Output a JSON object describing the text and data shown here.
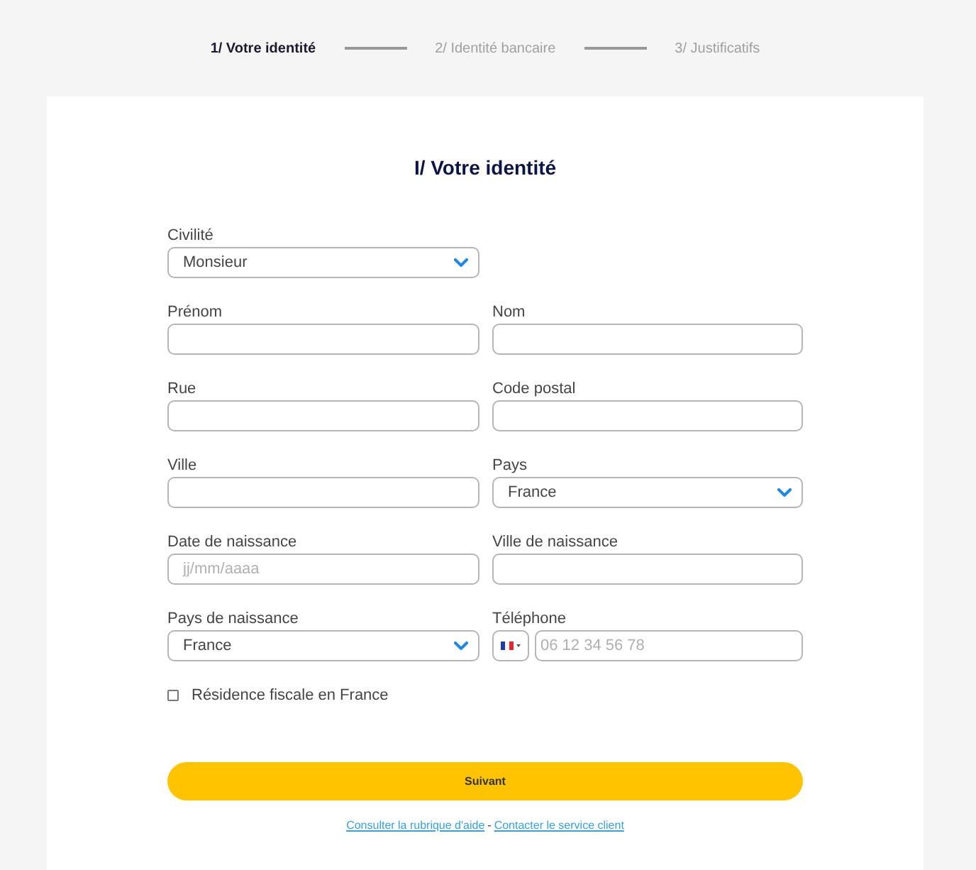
{
  "stepper": {
    "steps": [
      {
        "label": "1/ Votre identité",
        "selected": true
      },
      {
        "label": "2/ Identité bancaire",
        "selected": false
      },
      {
        "label": "3/ Justificatifs",
        "selected": false
      }
    ]
  },
  "form": {
    "title": "I/ Votre identité",
    "rows": [
      {
        "fields": [
          {
            "kind": "select",
            "label": "Civilité",
            "value": "Monsieur"
          }
        ]
      },
      {
        "fields": [
          {
            "kind": "text",
            "label": "Prénom"
          },
          {
            "kind": "text",
            "label": "Nom"
          }
        ]
      },
      {
        "fields": [
          {
            "kind": "text",
            "label": "Rue"
          },
          {
            "kind": "text",
            "label": "Code postal"
          }
        ]
      },
      {
        "fields": [
          {
            "kind": "text",
            "label": "Ville"
          },
          {
            "kind": "select",
            "label": "Pays",
            "value": "France"
          }
        ]
      },
      {
        "fields": [
          {
            "kind": "text",
            "label": "Date de naissance",
            "placeholder": "jj/mm/aaaa"
          },
          {
            "kind": "text",
            "label": "Ville de naissance"
          }
        ]
      },
      {
        "fields": [
          {
            "kind": "select",
            "label": "Pays de naissance",
            "value": "France"
          },
          {
            "kind": "phone",
            "label": "Téléphone",
            "placeholder": "06 12 34 56 78"
          }
        ]
      }
    ],
    "checkbox": {
      "label": "Résidence fiscale en France",
      "checked": false
    },
    "submit_button": "Suivant",
    "links": [
      "Consulter la rubrique d'aide",
      "Contacter le service client"
    ],
    "link_separator": "-"
  }
}
